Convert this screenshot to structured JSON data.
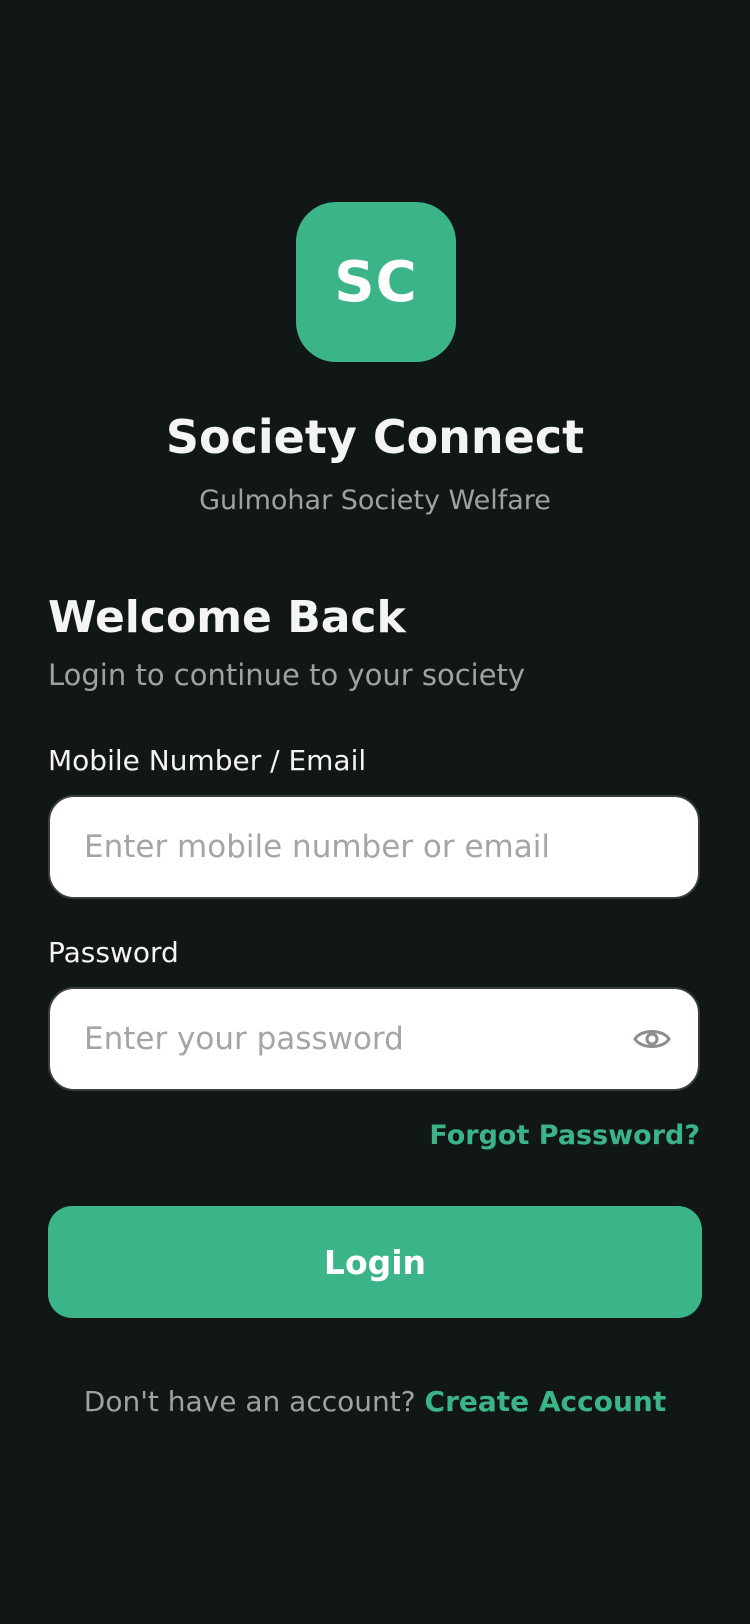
{
  "app": {
    "logo_text": "SC",
    "title": "Society Connect",
    "subtitle": "Gulmohar Society Welfare"
  },
  "welcome": {
    "heading": "Welcome Back",
    "subheading": "Login to continue to your society"
  },
  "form": {
    "identifier": {
      "label": "Mobile Number / Email",
      "placeholder": "Enter mobile number or email",
      "value": ""
    },
    "password": {
      "label": "Password",
      "placeholder": "Enter your password",
      "value": "",
      "toggle_icon": "eye-icon"
    },
    "forgot_label": "Forgot Password?",
    "login_label": "Login"
  },
  "signup": {
    "prompt": "Don't have an account?",
    "link_label": "Create Account"
  },
  "colors": {
    "background": "#111716",
    "accent": "#3bb488",
    "muted_text": "#9da3a1"
  }
}
